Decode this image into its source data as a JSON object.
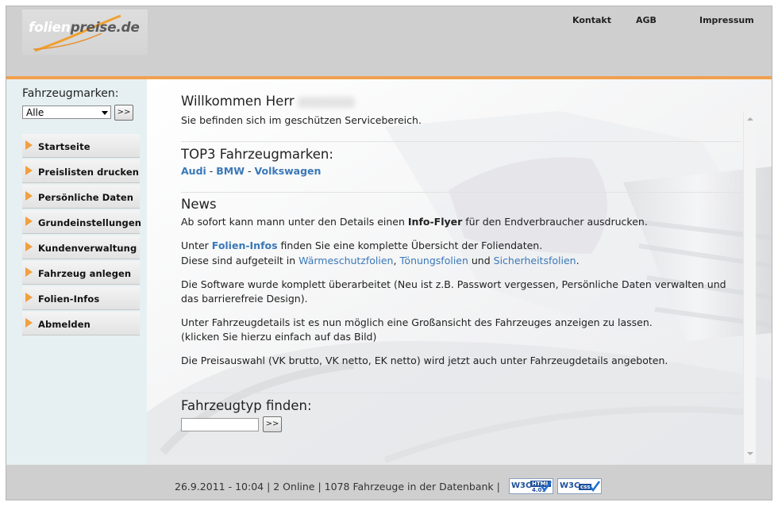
{
  "header": {
    "logo": {
      "part1": "folien",
      "part2": "preise.de"
    },
    "links": [
      "Kontakt",
      "AGB",
      "Impressum"
    ]
  },
  "sidebar": {
    "brand_label": "Fahrzeugmarken:",
    "brand_select_value": "Alle",
    "go_label": ">>",
    "menu": [
      "Startseite",
      "Preislisten drucken",
      "Persönliche Daten",
      "Grundeinstellungen",
      "Kundenverwaltung",
      "Fahrzeug anlegen",
      "Folien-Infos",
      "Abmelden"
    ]
  },
  "main": {
    "welcome_title": "Willkommen Herr",
    "welcome_sub": "Sie befinden sich im geschützen Servicebereich.",
    "top3_title": "TOP3 Fahrzeugmarken:",
    "top3_brands": [
      "Audi",
      "BMW",
      "Volkswagen"
    ],
    "top3_sep": " - ",
    "news_title": "News",
    "news": {
      "n1_a": "Ab sofort kann mann unter den Details einen ",
      "n1_b": "Info-Flyer",
      "n1_c": " für den Endverbraucher ausdrucken.",
      "n2_a": "Unter ",
      "n2_b": "Folien-Infos",
      "n2_c": " finden Sie eine komplette Übersicht der Foliendaten.",
      "n3_a": "Diese sind aufgeteilt in ",
      "n3_b": "Wärmeschutzfolien",
      "n3_c": ", ",
      "n3_d": "Tönungsfolien",
      "n3_e": " und ",
      "n3_f": "Sicherheitsfolien",
      "n3_g": ".",
      "n4": "Die Software wurde komplett überarbeitet (Neu ist z.B. Passwort vergessen, Persönliche Daten verwalten und",
      "n5": "das barrierefreie Design).",
      "n6": "Unter Fahrzeugdetails ist es nun möglich eine Großansicht des Fahrzeuges anzeigen zu lassen.",
      "n7": "(klicken Sie hierzu einfach auf das Bild)",
      "n8": "Die Preisauswahl (VK brutto, VK netto, EK netto) wird jetzt auch unter Fahrzeugdetails angeboten."
    },
    "type_title": "Fahrzeugtyp finden:",
    "type_input_value": "",
    "go_label": ">>"
  },
  "footer": {
    "status": "26.9.2011 - 10:04 | 2 Online | 1078 Fahrzeuge in der Datenbank |",
    "badge_html": {
      "w": "W3C",
      "t": "HTML",
      "t2": "4.01"
    },
    "badge_css": {
      "w": "W3C",
      "t": "css"
    }
  },
  "colors": {
    "accent": "#f0a050",
    "link": "#3a78b8",
    "header_bg": "#cfcfcf",
    "sidebar_bg": "#e6f0f2"
  }
}
